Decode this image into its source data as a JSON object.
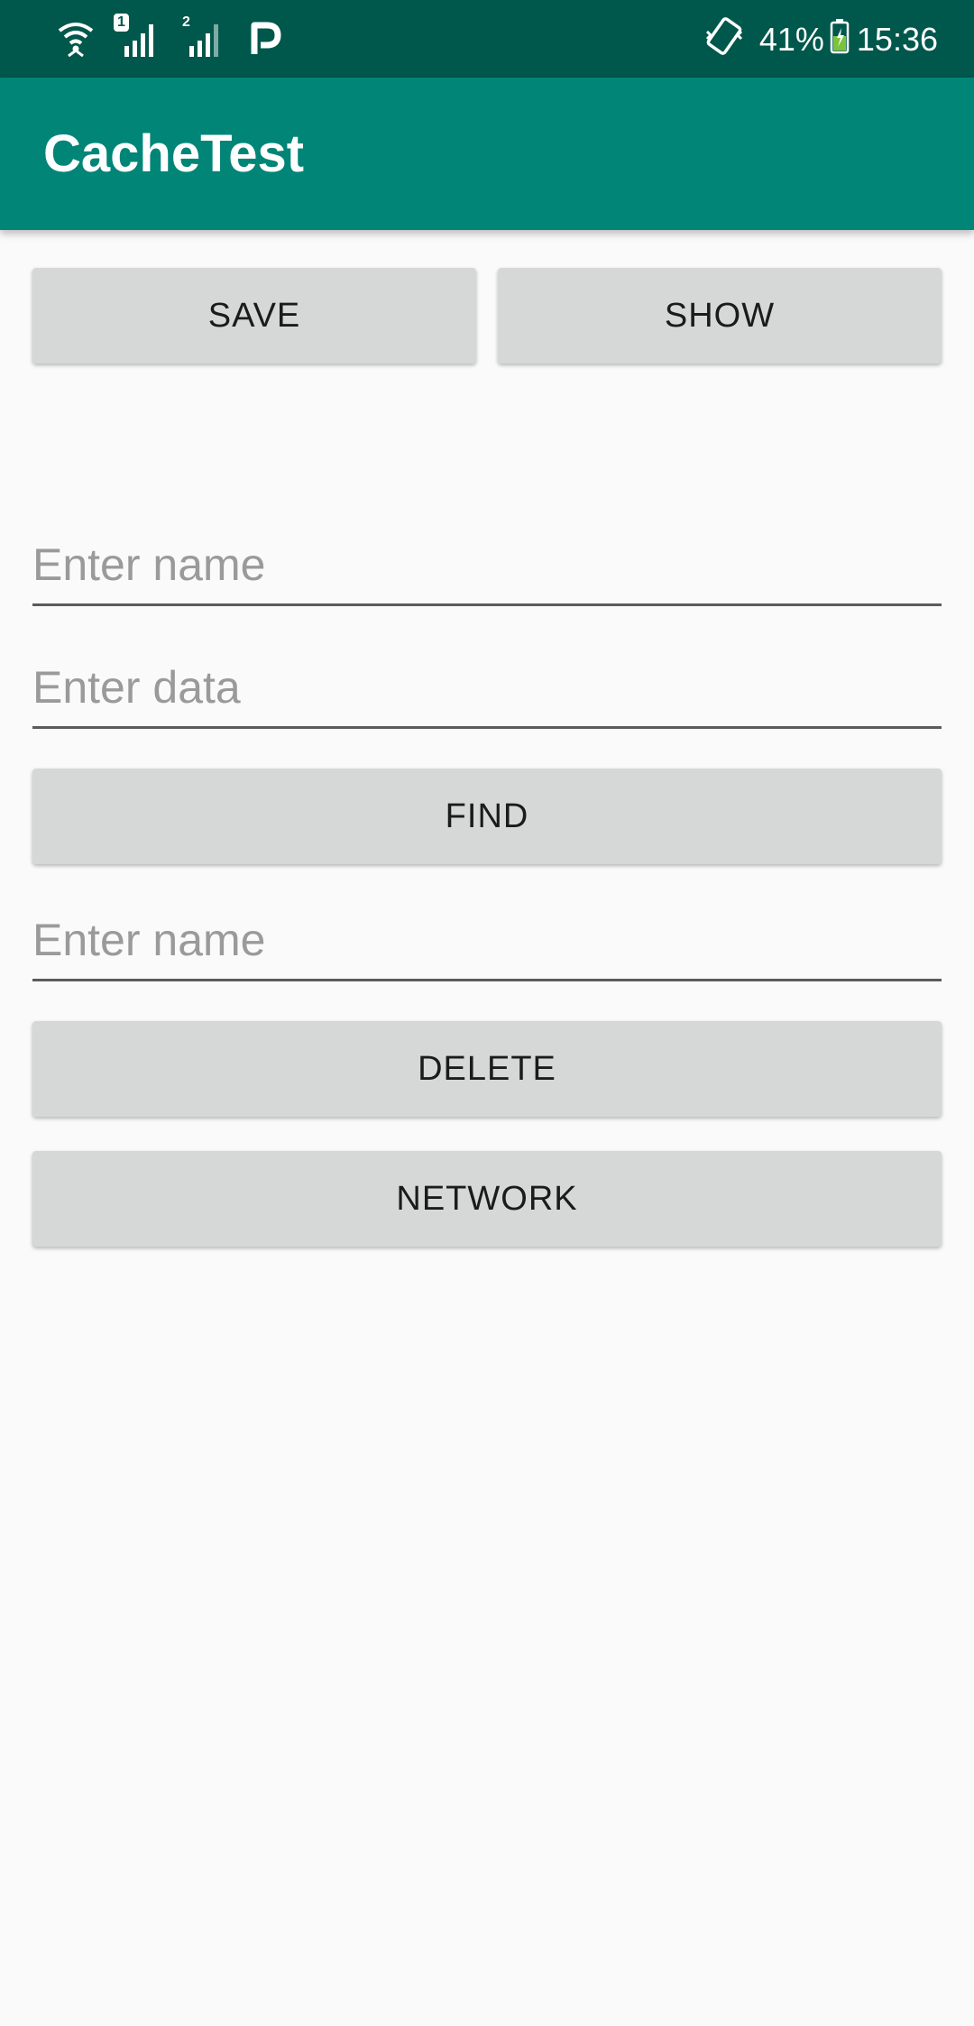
{
  "status_bar": {
    "sim1_badge": "1",
    "sim2_badge": "2",
    "battery_percent": "41%",
    "time": "15:36",
    "icons": [
      "wifi-icon",
      "signal-sim1-icon",
      "signal-sim2-icon",
      "parking-app-icon",
      "vibrate-icon",
      "battery-charging-icon"
    ]
  },
  "app_bar": {
    "title": "CacheTest"
  },
  "buttons": {
    "save": "SAVE",
    "show": "SHOW",
    "find": "FIND",
    "delete": "DELETE",
    "network": "NETWORK"
  },
  "fields": {
    "name_1": {
      "value": "",
      "placeholder": "Enter name"
    },
    "data": {
      "value": "",
      "placeholder": "Enter data"
    },
    "name_2": {
      "value": "",
      "placeholder": "Enter name"
    }
  },
  "colors": {
    "status_bar": "#00574b",
    "app_bar": "#008577",
    "button_bg": "#d6d7d7",
    "background": "#fafafa"
  }
}
